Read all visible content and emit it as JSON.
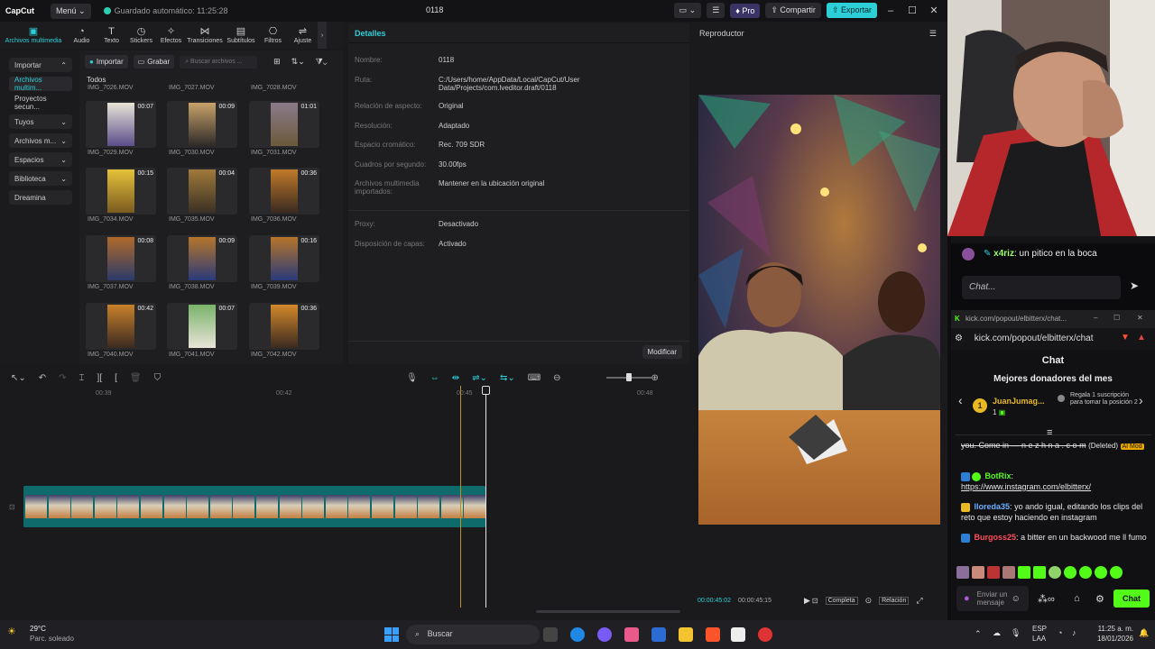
{
  "app": {
    "logo": "CapCut",
    "menu": "Menú",
    "autosave": "Guardado automático: 11:25:28",
    "project_title": "0118",
    "pro_label": "Pro",
    "share_label": "Compartir",
    "export_label": "Exportar"
  },
  "toolbar": {
    "tabs": [
      "Archivos multimedia",
      "Audio",
      "Texto",
      "Stickers",
      "Efectos",
      "Transiciones",
      "Subtítulos",
      "Filtros",
      "Ajuste"
    ]
  },
  "sidebar": {
    "items": [
      "Importar",
      "Archivos multim...",
      "Proyectos secun...",
      "Tuyos",
      "Archivos m...",
      "Espacios",
      "Biblioteca",
      "Dreamina"
    ]
  },
  "media": {
    "import_label": "Importar",
    "record_label": "Grabar",
    "search_placeholder": "Buscar archivos ...",
    "all_label": "Todos",
    "top_names": [
      "IMG_7026.MOV",
      "IMG_7027.MOV",
      "IMG_7028.MOV"
    ],
    "clips": [
      {
        "name": "IMG_7029.MOV",
        "duration": "00:07"
      },
      {
        "name": "IMG_7030.MOV",
        "duration": "00:09"
      },
      {
        "name": "IMG_7031.MOV",
        "duration": "01:01"
      },
      {
        "name": "IMG_7034.MOV",
        "duration": "00:15"
      },
      {
        "name": "IMG_7035.MOV",
        "duration": "00:04"
      },
      {
        "name": "IMG_7036.MOV",
        "duration": "00:36"
      },
      {
        "name": "IMG_7037.MOV",
        "duration": "00:08"
      },
      {
        "name": "IMG_7038.MOV",
        "duration": "00:09"
      },
      {
        "name": "IMG_7039.MOV",
        "duration": "00:16"
      },
      {
        "name": "IMG_7040.MOV",
        "duration": "00:42"
      },
      {
        "name": "IMG_7041.MOV",
        "duration": "00:07"
      },
      {
        "name": "IMG_7042.MOV",
        "duration": "00:36"
      }
    ]
  },
  "details": {
    "title": "Detalles",
    "rows": [
      {
        "label": "Nombre:",
        "value": "0118"
      },
      {
        "label": "Ruta:",
        "value": "C:/Users/home/AppData/Local/CapCut/User Data/Projects/com.lveditor.draft/0118"
      },
      {
        "label": "Relación de aspecto:",
        "value": "Original"
      },
      {
        "label": "Resolución:",
        "value": "Adaptado"
      },
      {
        "label": "Espacio cromático:",
        "value": "Rec. 709 SDR"
      },
      {
        "label": "Cuadros por segundo:",
        "value": "30.00fps"
      },
      {
        "label": "Archivos multimedia importados:",
        "value": "Mantener en la ubicación original"
      },
      {
        "label": "Proxy:",
        "value": "Desactivado"
      },
      {
        "label": "Disposición de capas:",
        "value": "Activado"
      }
    ],
    "modify_label": "Modificar"
  },
  "player": {
    "title": "Reproductor",
    "current_time": "00:00:45:02",
    "total_time": "00:00:45:15",
    "full_label": "Completa",
    "ratio_label": "Relación"
  },
  "timeline": {
    "ticks": [
      "00:39",
      "00:42",
      "00:45",
      "00:48"
    ]
  },
  "chat": {
    "top_message": {
      "user": "x4riz",
      "text": "un pitico en la boca"
    },
    "input_placeholder": "Chat...",
    "browser_url_small": "kick.com/popout/elbitterx/chat...",
    "browser_url": "kick.com/popout/elbitterx/chat",
    "header": "Chat",
    "donors_title": "Mejores donadores del mes",
    "donor_rank": "1",
    "donor_name": "JuanJumag...",
    "donor_count": "1",
    "donor_cta": "Regala 1 suscripción para tomar la posición 2",
    "messages": [
      {
        "user": "",
        "text": "you. Come in — n e z h n a . c o m",
        "extra": "(Deleted)",
        "mod": "AI Mod"
      },
      {
        "user": "BotRix",
        "text": "https://www.instagram.com/elbitterx/"
      },
      {
        "user": "lloreda35",
        "text": "yo ando igual, editando los clips del reto que estoy haciendo en instagram"
      },
      {
        "user": "Burgoss25",
        "text": "a bitter en un backwood me ll fumo"
      }
    ],
    "send_placeholder": "Enviar un mensaje",
    "chat_button": "Chat"
  },
  "taskbar": {
    "temp": "29°C",
    "weather": "Parc. soleado",
    "search": "Buscar",
    "lang": "ESP",
    "lang2": "LAA",
    "time": "11:25 a. m.",
    "date": "18/01/2026"
  },
  "colors": {
    "accent": "#2ccfd8",
    "kick_green": "#53fc18",
    "track": "#0f6b6b"
  }
}
